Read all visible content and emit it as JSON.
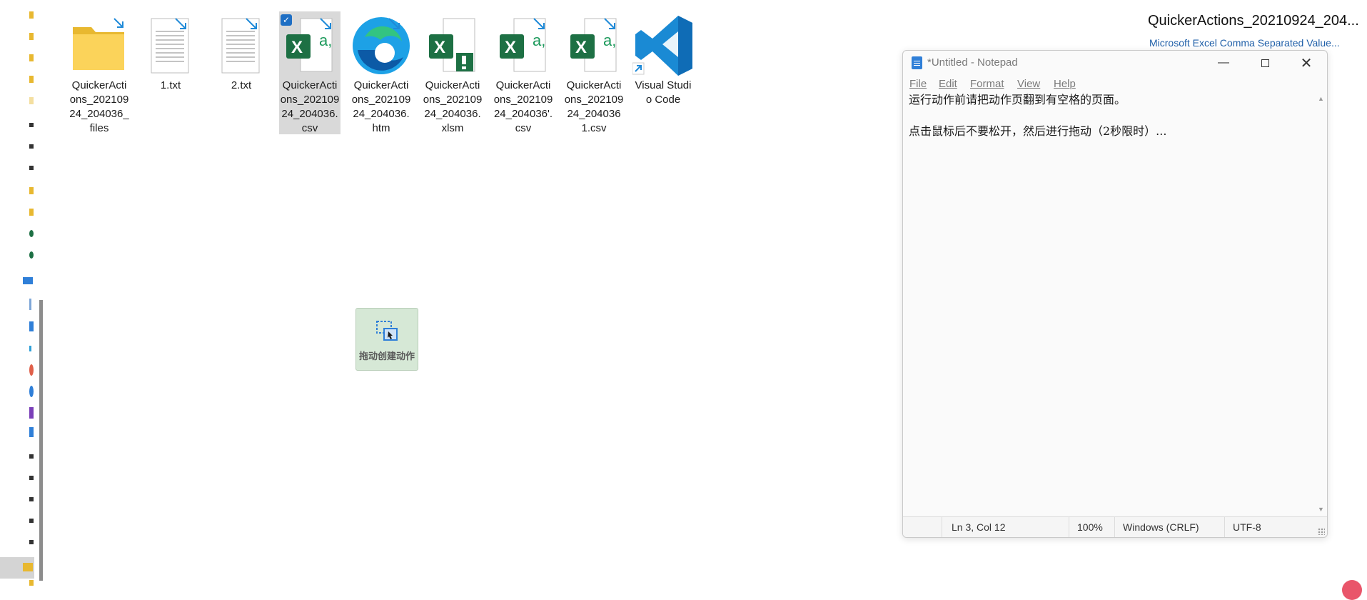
{
  "desktop": {
    "icons": [
      {
        "label": "QuickerActions_20210924_204036_files",
        "type": "folder"
      },
      {
        "label": "1.txt",
        "type": "text-file"
      },
      {
        "label": "2.txt",
        "type": "text-file"
      },
      {
        "label": "QuickerActions_20210924_204036.csv",
        "type": "excel-csv",
        "selected": true
      },
      {
        "label": "QuickerActions_20210924_204036.htm",
        "type": "edge-html"
      },
      {
        "label": "QuickerActions_20210924_204036.xlsm",
        "type": "excel-macro"
      },
      {
        "label": "QuickerActions_20210924_204036'.csv",
        "type": "excel-csv"
      },
      {
        "label": "QuickerActions_20210924_2040361.csv",
        "type": "excel-csv"
      },
      {
        "label": "Visual Studio Code",
        "type": "vscode-shortcut"
      }
    ]
  },
  "drag_tile": {
    "label": "拖动创建动作",
    "icon": "drag-select-icon"
  },
  "file_info": {
    "title": "QuickerActions_20210924_204...",
    "type": "Microsoft Excel Comma Separated Value..."
  },
  "notepad": {
    "title": "*Untitled - Notepad",
    "menu": [
      "File",
      "Edit",
      "Format",
      "View",
      "Help"
    ],
    "lines": [
      "运行动作前请把动作页翻到有空格的页面。",
      "",
      "点击鼠标后不要松开，然后进行拖动（2秒限时）..."
    ],
    "status": {
      "position": "Ln 3, Col 12",
      "zoom": "100%",
      "line_ending": "Windows (CRLF)",
      "encoding": "UTF-8"
    }
  },
  "colors": {
    "excel_green": "#1d7044",
    "accent_blue": "#1f6fc4",
    "vscode_blue": "#1a8ad4",
    "drag_tile_bg": "#d6e8d6"
  }
}
